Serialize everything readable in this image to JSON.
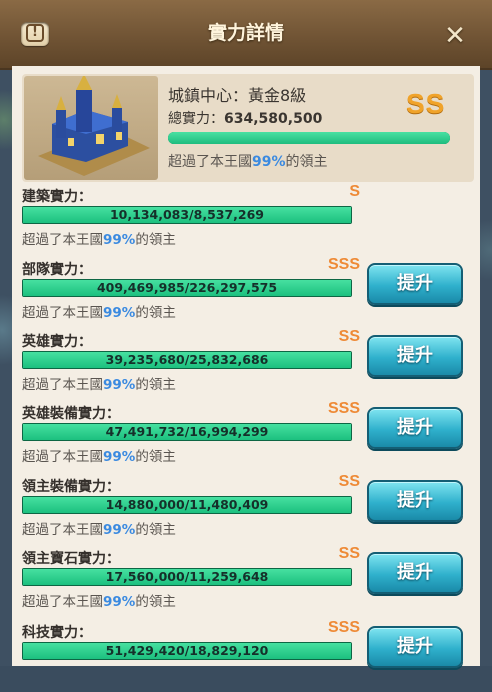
{
  "header": {
    "title": "實力詳情",
    "alert_icon": "alert-icon",
    "close_icon": "close-icon"
  },
  "summary": {
    "name": "城鎮中心：黃金8級",
    "power_label": "總實力：",
    "power_value": "634,580,500",
    "rank": "SS",
    "progress": 1.0,
    "pct_prefix": "超過了本王國",
    "pct_value": "99%",
    "pct_suffix": "的領主"
  },
  "upgrade_label": "提升",
  "rows": [
    {
      "label": "建築實力：",
      "rank": "S",
      "value": "10,134,083/8,537,269",
      "progress": 1.0,
      "pct_prefix": "超過了本王國",
      "pct_value": "99%",
      "pct_suffix": "的領主",
      "has_upgrade": false
    },
    {
      "label": "部隊實力：",
      "rank": "SSS",
      "value": "409,469,985/226,297,575",
      "progress": 1.0,
      "pct_prefix": "超過了本王國",
      "pct_value": "99%",
      "pct_suffix": "的領主",
      "has_upgrade": true
    },
    {
      "label": "英雄實力：",
      "rank": "SS",
      "value": "39,235,680/25,832,686",
      "progress": 1.0,
      "pct_prefix": "超過了本王國",
      "pct_value": "99%",
      "pct_suffix": "的領主",
      "has_upgrade": true
    },
    {
      "label": "英雄裝備實力：",
      "rank": "SSS",
      "value": "47,491,732/16,994,299",
      "progress": 1.0,
      "pct_prefix": "超過了本王國",
      "pct_value": "99%",
      "pct_suffix": "的領主",
      "has_upgrade": true
    },
    {
      "label": "領主裝備實力：",
      "rank": "SS",
      "value": "14,880,000/11,480,409",
      "progress": 1.0,
      "pct_prefix": "超過了本王國",
      "pct_value": "99%",
      "pct_suffix": "的領主",
      "has_upgrade": true
    },
    {
      "label": "領主寶石實力：",
      "rank": "SS",
      "value": "17,560,000/11,259,648",
      "progress": 1.0,
      "pct_prefix": "超過了本王國",
      "pct_value": "99%",
      "pct_suffix": "的領主",
      "has_upgrade": true
    },
    {
      "label": "科技實力：",
      "rank": "SSS",
      "value": "51,429,420/18,829,120",
      "progress": 1.0,
      "pct_prefix": "",
      "pct_value": "",
      "pct_suffix": "",
      "has_upgrade": true
    }
  ]
}
